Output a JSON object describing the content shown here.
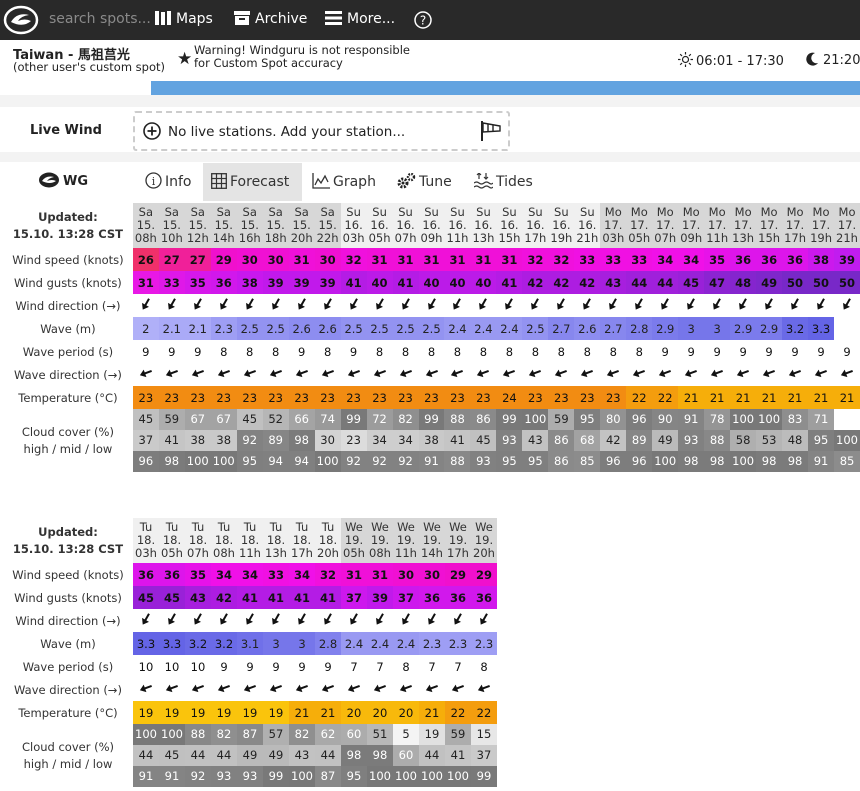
{
  "topbar": {
    "search_placeholder": "search spots...",
    "maps": "Maps",
    "archive": "Archive",
    "more": "More..."
  },
  "spot": {
    "name": "Taiwan - 馬祖莒光",
    "subtitle": "(other user's custom spot)",
    "warning_line1": "Warning! Windguru is not responsible",
    "warning_line2": "for Custom Spot accuracy",
    "sun": "06:01 - 17:30",
    "moon": "21:20"
  },
  "live_wind": {
    "label": "Live Wind",
    "text": "No live stations. Add your station..."
  },
  "tabs": {
    "logo": "WG",
    "info": "Info",
    "forecast": "Forecast",
    "graph": "Graph",
    "tune": "Tune",
    "tides": "Tides"
  },
  "colors": {
    "wind_26": "#f0306a",
    "wind_magenta": "#f010d8",
    "gusts_31": "#e818e6",
    "gusts_purple": "#9a2aee",
    "wave": "#7e7cec",
    "temp": "#f29a12",
    "cloud_dark": "#7c7c7c",
    "accent_blue": "#62a3e0"
  },
  "labels": {
    "updated": "Updated:",
    "updated_time": "15.10. 13:28 CST",
    "wind_speed": "Wind speed (knots)",
    "wind_gusts": "Wind gusts (knots)",
    "wind_direction": "Wind direction (→)",
    "wave": "Wave (m)",
    "wave_period": "Wave period (s)",
    "wave_direction": "Wave direction (→)",
    "temperature": "Temperature (°C)",
    "cloud1": "Cloud cover (%)",
    "cloud2": "high / mid / low"
  },
  "table1": {
    "days": [
      "Sa",
      "Sa",
      "Sa",
      "Sa",
      "Sa",
      "Sa",
      "Sa",
      "Sa",
      "Su",
      "Su",
      "Su",
      "Su",
      "Su",
      "Su",
      "Su",
      "Su",
      "Su",
      "Su",
      "Mo",
      "Mo",
      "Mo",
      "Mo",
      "Mo",
      "Mo",
      "Mo",
      "Mo",
      "Mo",
      "Mo"
    ],
    "dates": [
      "15.",
      "15.",
      "15.",
      "15.",
      "15.",
      "15.",
      "15.",
      "15.",
      "16.",
      "16.",
      "16.",
      "16.",
      "16.",
      "16.",
      "16.",
      "16.",
      "16.",
      "16.",
      "17.",
      "17.",
      "17.",
      "17.",
      "17.",
      "17.",
      "17.",
      "17.",
      "17.",
      "17."
    ],
    "hours": [
      "08h",
      "10h",
      "12h",
      "14h",
      "16h",
      "18h",
      "20h",
      "22h",
      "03h",
      "05h",
      "07h",
      "09h",
      "11h",
      "13h",
      "15h",
      "17h",
      "19h",
      "21h",
      "03h",
      "05h",
      "07h",
      "09h",
      "11h",
      "13h",
      "15h",
      "17h",
      "19h",
      "21h"
    ],
    "wind_speed": [
      26,
      27,
      27,
      29,
      30,
      30,
      31,
      30,
      32,
      31,
      31,
      31,
      31,
      31,
      31,
      32,
      32,
      33,
      33,
      33,
      34,
      34,
      35,
      36,
      36,
      36,
      38,
      39
    ],
    "wind_gusts": [
      31,
      33,
      35,
      36,
      38,
      39,
      39,
      39,
      41,
      40,
      41,
      40,
      40,
      40,
      41,
      42,
      42,
      42,
      43,
      44,
      44,
      45,
      47,
      48,
      49,
      50,
      50,
      50
    ],
    "wave": [
      "2",
      "2.1",
      "2.1",
      "2.3",
      "2.5",
      "2.5",
      "2.6",
      "2.6",
      "2.5",
      "2.5",
      "2.5",
      "2.5",
      "2.4",
      "2.4",
      "2.4",
      "2.5",
      "2.7",
      "2.6",
      "2.7",
      "2.8",
      "2.9",
      "3",
      "3",
      "2.9",
      "2.9",
      "3.2",
      "3.3",
      ""
    ],
    "wave_period": [
      9,
      9,
      9,
      8,
      8,
      8,
      9,
      8,
      9,
      8,
      8,
      8,
      8,
      8,
      8,
      8,
      8,
      8,
      8,
      8,
      9,
      9,
      9,
      9,
      9,
      9,
      9,
      9
    ],
    "temperature": [
      23,
      23,
      23,
      23,
      23,
      23,
      23,
      23,
      23,
      23,
      23,
      23,
      23,
      23,
      24,
      23,
      23,
      23,
      23,
      22,
      22,
      21,
      21,
      21,
      21,
      21,
      21,
      21
    ],
    "cloud_high": [
      45,
      59,
      67,
      67,
      45,
      52,
      66,
      74,
      99,
      72,
      82,
      99,
      88,
      86,
      99,
      100,
      59,
      95,
      80,
      96,
      90,
      91,
      78,
      100,
      100,
      83,
      71,
      ""
    ],
    "cloud_mid": [
      37,
      41,
      38,
      38,
      92,
      89,
      98,
      30,
      23,
      34,
      34,
      38,
      41,
      45,
      93,
      43,
      86,
      68,
      42,
      89,
      49,
      93,
      88,
      58,
      53,
      48,
      95,
      100
    ],
    "cloud_low": [
      96,
      98,
      100,
      100,
      95,
      94,
      94,
      100,
      92,
      92,
      92,
      91,
      88,
      93,
      95,
      95,
      86,
      85,
      96,
      96,
      100,
      98,
      98,
      100,
      98,
      98,
      91,
      85
    ]
  },
  "table2": {
    "days": [
      "Tu",
      "Tu",
      "Tu",
      "Tu",
      "Tu",
      "Tu",
      "Tu",
      "Tu",
      "We",
      "We",
      "We",
      "We",
      "We",
      "We"
    ],
    "dates": [
      "18.",
      "18.",
      "18.",
      "18.",
      "18.",
      "18.",
      "18.",
      "18.",
      "19.",
      "19.",
      "19.",
      "19.",
      "19.",
      "19."
    ],
    "hours": [
      "03h",
      "05h",
      "07h",
      "08h",
      "11h",
      "13h",
      "17h",
      "20h",
      "05h",
      "08h",
      "11h",
      "14h",
      "17h",
      "20h"
    ],
    "wind_speed": [
      36,
      36,
      35,
      34,
      34,
      33,
      34,
      32,
      31,
      31,
      30,
      30,
      29,
      29
    ],
    "wind_gusts": [
      45,
      45,
      43,
      42,
      41,
      41,
      41,
      41,
      37,
      39,
      37,
      36,
      36,
      36
    ],
    "wave": [
      "3.3",
      "3.3",
      "3.2",
      "3.2",
      "3.1",
      "3",
      "3",
      "2.8",
      "2.4",
      "2.4",
      "2.4",
      "2.3",
      "2.3",
      "2.3"
    ],
    "wave_period": [
      10,
      10,
      10,
      9,
      9,
      9,
      9,
      9,
      7,
      7,
      8,
      7,
      7,
      8
    ],
    "temperature": [
      19,
      19,
      19,
      19,
      19,
      19,
      21,
      21,
      20,
      20,
      20,
      21,
      22,
      22
    ],
    "cloud_high": [
      100,
      100,
      88,
      82,
      87,
      57,
      82,
      62,
      60,
      51,
      5,
      19,
      59,
      15
    ],
    "cloud_mid": [
      44,
      45,
      44,
      44,
      49,
      49,
      43,
      44,
      98,
      98,
      60,
      44,
      41,
      37
    ],
    "cloud_low": [
      91,
      91,
      92,
      93,
      93,
      99,
      100,
      87,
      95,
      100,
      100,
      100,
      100,
      99
    ]
  }
}
